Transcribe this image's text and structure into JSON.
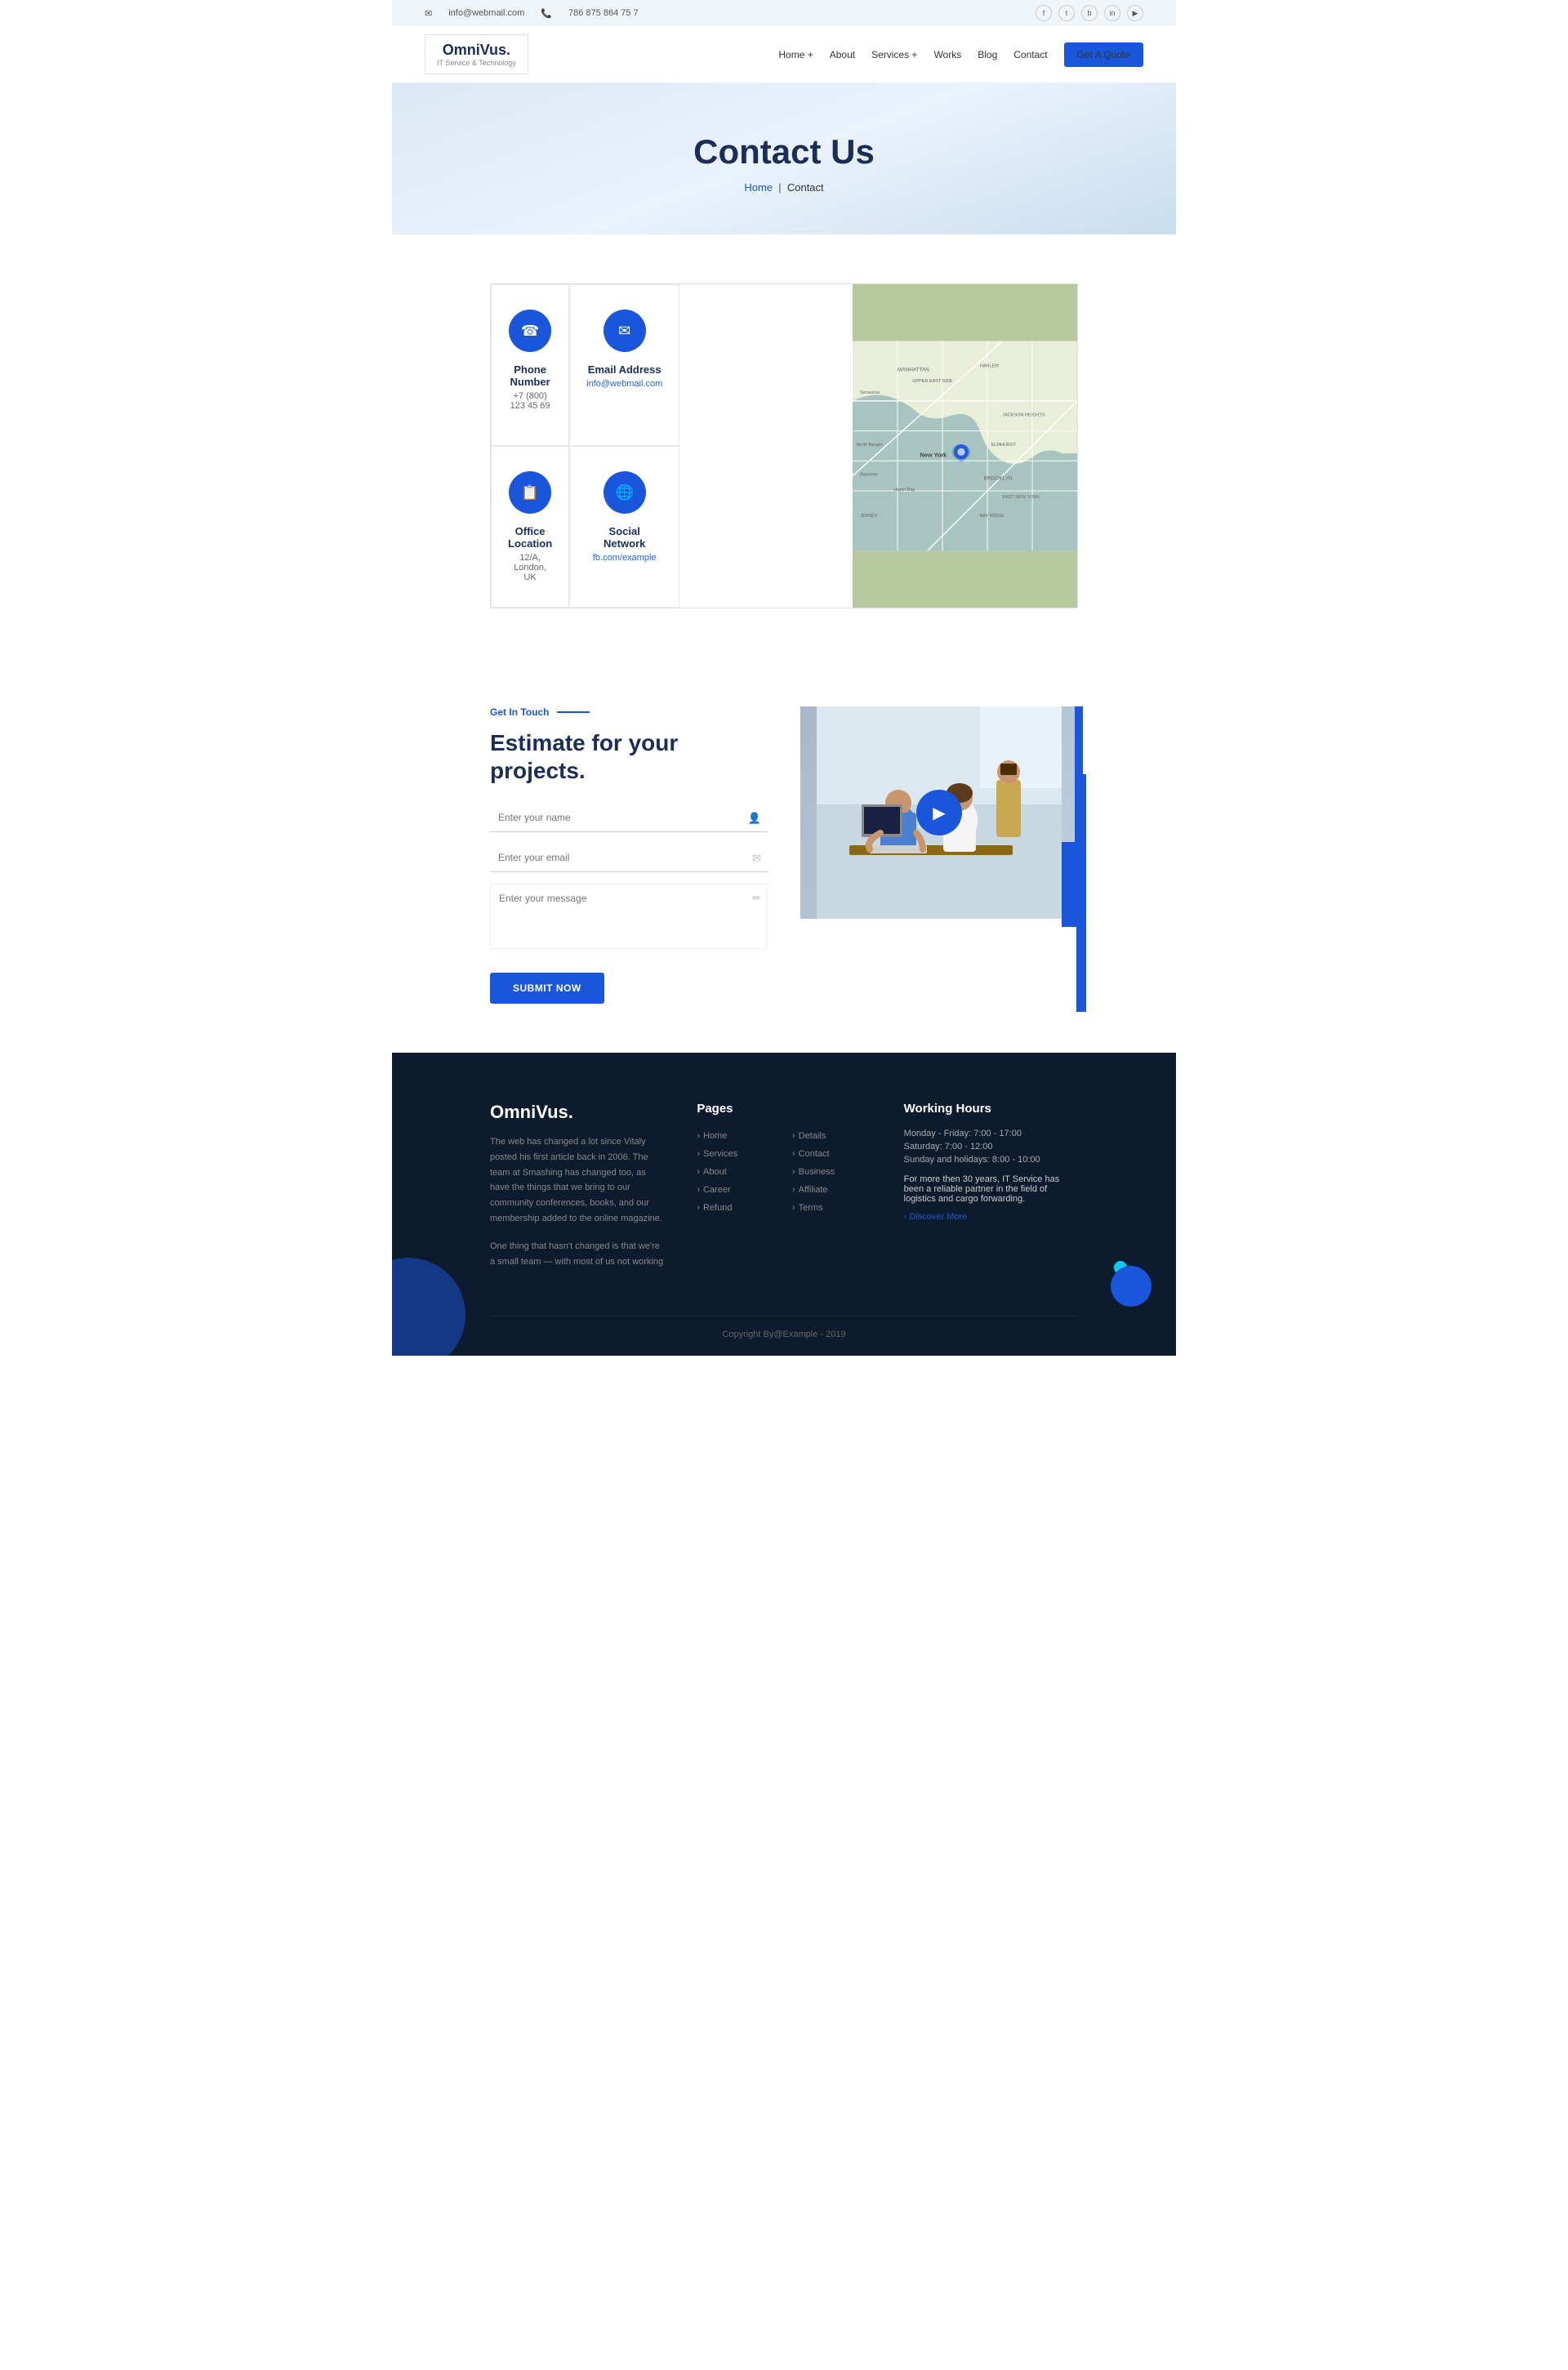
{
  "topbar": {
    "email": "info@webmail.com",
    "phone": "786 875 864 75 7",
    "social": [
      "f",
      "t",
      "in",
      "li",
      "yt"
    ]
  },
  "header": {
    "logo_name": "OmniVus.",
    "logo_tagline": "IT Service & Technology",
    "nav": [
      {
        "label": "Home +",
        "href": "#"
      },
      {
        "label": "About",
        "href": "#"
      },
      {
        "label": "Services +",
        "href": "#"
      },
      {
        "label": "Works",
        "href": "#"
      },
      {
        "label": "Blog",
        "href": "#"
      },
      {
        "label": "Contact",
        "href": "#"
      }
    ],
    "cta": "Get A Quote"
  },
  "hero": {
    "title": "Contact Us",
    "breadcrumb_home": "Home",
    "breadcrumb_current": "Contact"
  },
  "contact_cards": [
    {
      "title": "Phone Number",
      "value": "+7 (800) 123 45 69",
      "icon": "☎",
      "value_class": "dark"
    },
    {
      "title": "Email Address",
      "value": "info@webmail.com",
      "icon": "✉",
      "value_class": ""
    },
    {
      "title": "Office Location",
      "value": "12/A, London, UK",
      "icon": "📖",
      "value_class": "dark"
    },
    {
      "title": "Social Network",
      "value": "fb.com/example",
      "icon": "🌐",
      "value_class": ""
    }
  ],
  "estimate": {
    "label": "Get In Touch",
    "title": "Estimate for your projects.",
    "name_placeholder": "Enter your name",
    "email_placeholder": "Enter your email",
    "message_placeholder": "Enter your message",
    "submit_label": "Submit Now"
  },
  "footer": {
    "brand": "OmniVus.",
    "desc1": "The web has changed a lot since Vitaly posted his first article back in 2006. The team at Smashing has changed too, as have the things that we bring to our community conferences, books, and our membership added to the online magazine.",
    "desc2": "One thing that hasn't changed is that we're a small team — with most of us not working",
    "pages_title": "Pages",
    "pages": [
      {
        "label": "Home"
      },
      {
        "label": "Details"
      },
      {
        "label": "Services"
      },
      {
        "label": "Contact"
      },
      {
        "label": "About"
      },
      {
        "label": "Business"
      },
      {
        "label": "Career"
      },
      {
        "label": "Affiliate"
      },
      {
        "label": "Refund"
      },
      {
        "label": "Terms"
      }
    ],
    "hours_title": "Working Hours",
    "hours": [
      "Monday - Friday: 7:00 - 17:00",
      "Saturday: 7:00 - 12:00",
      "Sunday and holidays: 8:00 - 10:00"
    ],
    "hours_desc": "For more then 30 years, IT Service has been a reliable partner in the field of logistics and cargo forwarding.",
    "discover_link": "› Discover More",
    "copyright": "Copyright By@Example - 2019"
  }
}
